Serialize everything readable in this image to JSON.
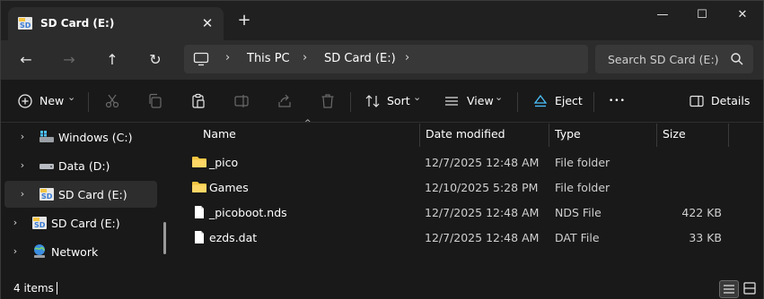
{
  "tab": {
    "title": "SD Card (E:)",
    "close_glyph": "✕",
    "new_glyph": "+"
  },
  "window_controls": {
    "minimize": "—",
    "maximize": "☐",
    "close": "✕"
  },
  "nav": {
    "back": "←",
    "forward": "→",
    "up": "↑",
    "refresh": "↻"
  },
  "breadcrumb": [
    {
      "label": "This PC"
    },
    {
      "label": "SD Card (E:)"
    }
  ],
  "crumb_sep": "›",
  "search": {
    "placeholder": "Search SD Card (E:)"
  },
  "toolbar": {
    "new_label": "New",
    "sort_label": "Sort",
    "view_label": "View",
    "eject_label": "Eject",
    "more_glyph": "•••",
    "details_label": "Details",
    "dropdown_glyph": "⌄"
  },
  "navpane": {
    "items": [
      {
        "label": "Windows (C:)",
        "icon": "windows-drive-icon"
      },
      {
        "label": "Data (D:)",
        "icon": "drive-icon"
      },
      {
        "label": "SD Card (E:)",
        "icon": "sd-card-icon"
      },
      {
        "label": "SD Card (E:)",
        "icon": "sd-card-icon"
      },
      {
        "label": "Network",
        "icon": "network-icon"
      }
    ],
    "chevron": "›"
  },
  "columns": {
    "name": "Name",
    "date": "Date modified",
    "type": "Type",
    "size": "Size",
    "sort_glyph": "^"
  },
  "files": [
    {
      "name": "_pico",
      "date": "12/7/2025 12:48 AM",
      "type": "File folder",
      "size": "",
      "icon": "folder-icon"
    },
    {
      "name": "Games",
      "date": "12/10/2025 5:28 PM",
      "type": "File folder",
      "size": "",
      "icon": "folder-icon"
    },
    {
      "name": "_picoboot.nds",
      "date": "12/7/2025 12:48 AM",
      "type": "NDS File",
      "size": "422 KB",
      "icon": "file-icon"
    },
    {
      "name": "ezds.dat",
      "date": "12/7/2025 12:48 AM",
      "type": "DAT File",
      "size": "33 KB",
      "icon": "file-icon"
    }
  ],
  "status": {
    "count": "4 items"
  },
  "colors": {
    "accent": "#4cc2ff",
    "folder": "#f4c542",
    "sd_blue": "#3a7bd5"
  }
}
